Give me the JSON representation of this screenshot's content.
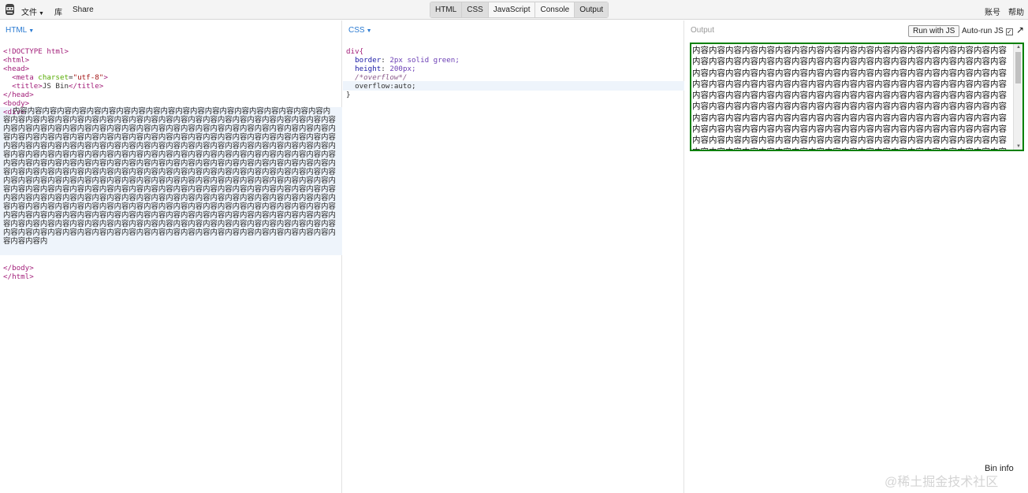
{
  "topbar": {
    "file_label": "文件",
    "library_label": "库",
    "share_label": "Share",
    "account_label": "账号",
    "help_label": "帮助",
    "tabs": [
      "HTML",
      "CSS",
      "JavaScript",
      "Console",
      "Output"
    ]
  },
  "html_panel": {
    "label": "HTML",
    "lines_before": [
      "<!DOCTYPE html>",
      "<html>",
      "<head>",
      "  <meta charset=\"utf-8\">",
      "  <title>JS Bin</title>",
      "</head>",
      "<body>",
      "<div>"
    ],
    "div_text": "内容内容内容内容内容内容内容内容内容内容内容内容内容内容内容内容内容内容内容内容内容内容内容内容内容内容内容内容内容内容内容内容内容内容内容内容内容内容内容内容内容内容内容内容内容内容内容内容内容内容内容内容内容内容内容内容内容内容内容内容内容内容内容内容内容内容内容内容内容内容内容内容内容内容内容内容内容内容内容内容内容内容内容内容内容内容内容内容内容内容内容内容内容内容内容内容内容内容内容内容内容内容内容内容内容内容内容内容内容内容内容内容内容内容内容内容内容内容内容内容内容内容内容内容内容内容内容内容内容内容内容内容内容内容内容内容内容内容内容内容内容内容内容内容内容内容内容内容内容内容内容内容内容内容内容内容内容内容内容内容内容内容内容内容内容内容内容内容内容内容内容内容内容内容内容内容内容内容内容内容内容内容内容内容内容内容内容内容内容内容内容内容内容内容内容内容内容内容内容内容内容内容内容内容内容内容内容内容内容内容内容内容内容内容内容内容内容内容内容内容内容内容内容内容内容内容内容内容内容内容内容内容内容内容内容内容内容内容内容内容内容内容内容内容内容内容内容内容内容内容内容内容内容内容内容内容内容内容内容内容内容内容内容内容内容内容内容内容内容内容内容内容内容内容内容内容内容内容内容内容内容内容内容内容内容内容内容内容内容内容内容内容内容内容内容内容内容内容内容内容内容内容内容内容内容内容内容内容内容内容内容内容内容内容内容内容内容内容内容内容内容内容内容内容内容内容内容内容内容内容内容内容内容内容内容内容内容内容内容内",
    "lines_after": [
      "</body>",
      "</html>"
    ]
  },
  "css_panel": {
    "label": "CSS",
    "selector": "div{",
    "lines": [
      {
        "prop": "border",
        "value": "2px solid green;"
      },
      {
        "prop": "height",
        "value": "200px;"
      }
    ],
    "comment": "/*overflow*/",
    "overflow_line": "overflow:auto;",
    "close": "}"
  },
  "output_panel": {
    "label": "Output",
    "run_button": "Run with JS",
    "autorun_label": "Auto-run JS",
    "autorun_checked": "✓",
    "popout_icon": "↗",
    "demo_text": "内容内容内容内容内容内容内容内容内容内容内容内容内容内容内容内容内容内容内容内容内容内容内容内容内容内容内容内容内容内容内容内容内容内容内容内容内容内容内容内容内容内容内容内容内容内容内容内容内容内容内容内容内容内容内容内容内容内容内容内容内容内容内容内容内容内容内容内容内容内容内容内容内容内容内容内容内容内容内容内容内容内容内容内容内容内容内容内容内容内容内容内容内容内容内容内容内容内容内容内容内容内容内容内容内容内容内容内容内容内容内容内容内容内容内容内容内容内容内容内容内容内容内容内容内容内容内容内容内容内容内容内容内容内容内容内容内容内容内容内容内容内容内容内容内容内容内容内容内容内容内容内容内容内容内容内容内容内容内容内容内容内容内容内容内容内容内容内容内容内容内容内容内容内容内容内容内容内容内容内容内容内容内容内容内容内容内容内容内容内容内容内容内容内容内容内容内容内容内容内容内容内容内容内容内容内容内容内容内容内容内容内容内容内容内容内容内容内容"
  },
  "footer": {
    "bin_info": "Bin info",
    "watermark": "@稀土掘金技术社区"
  }
}
